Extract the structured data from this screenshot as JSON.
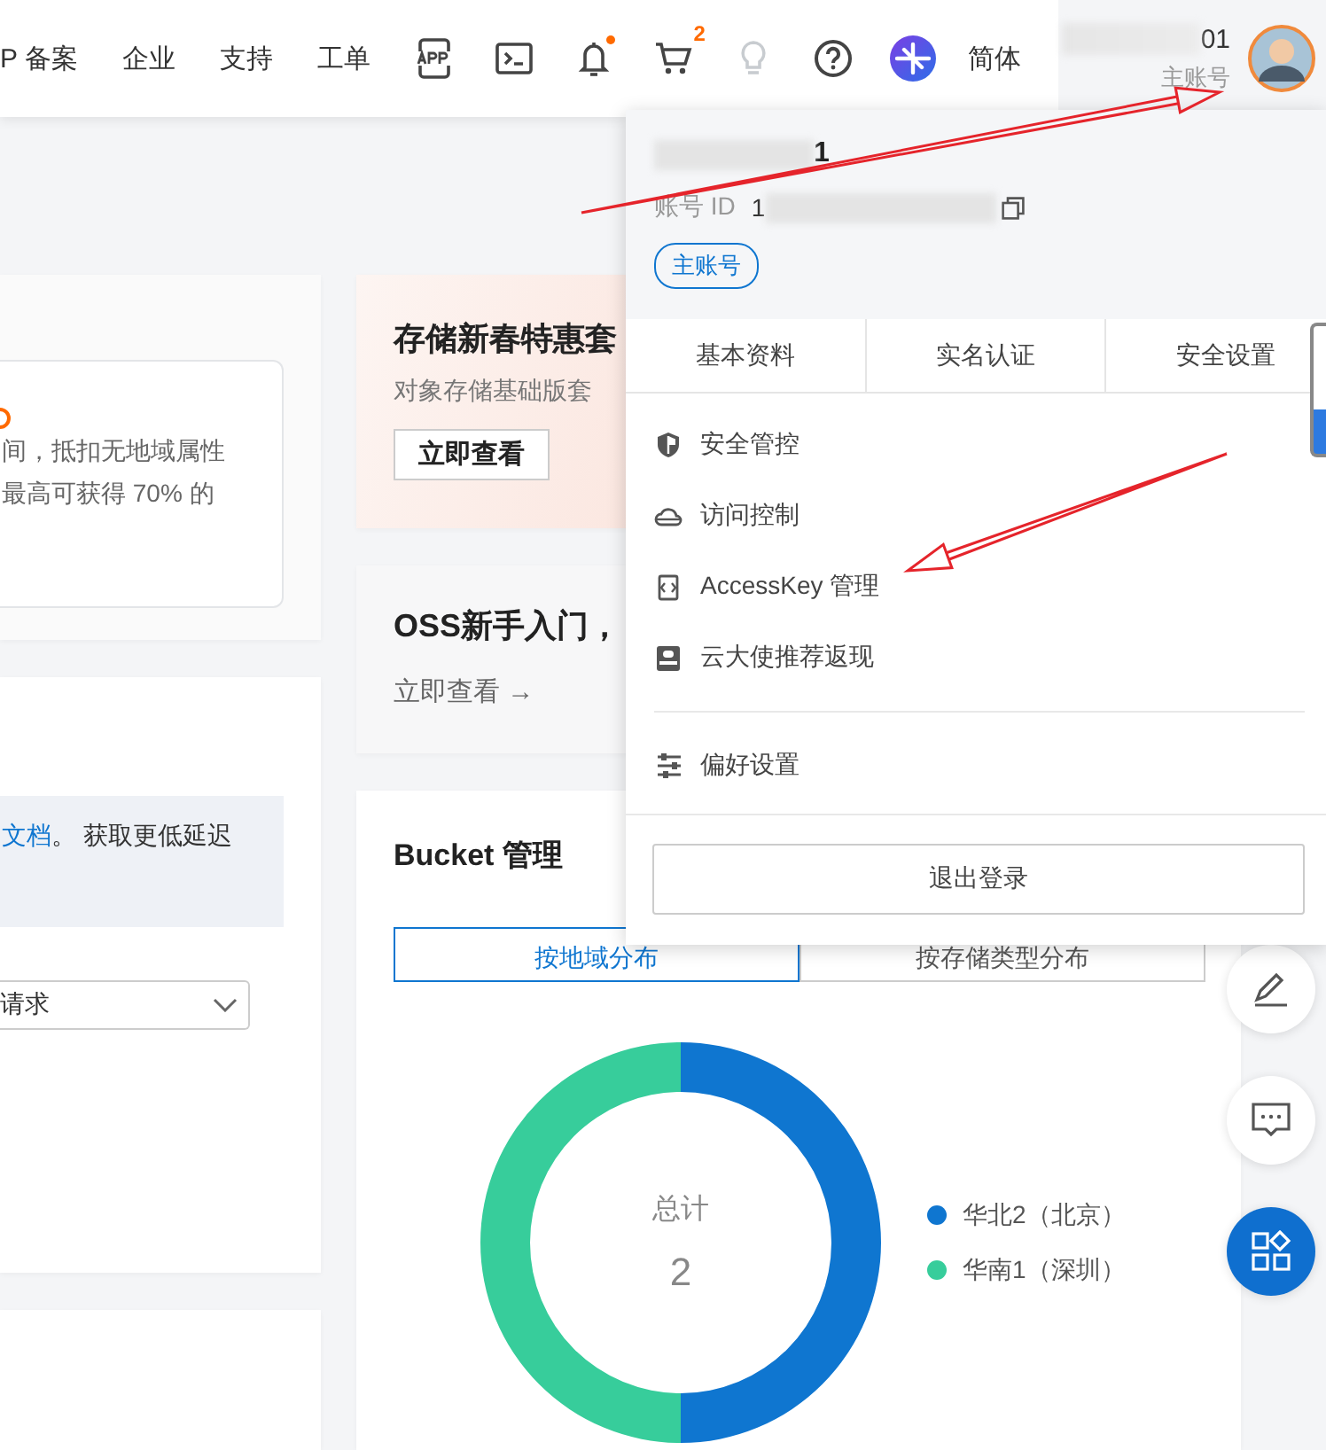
{
  "header": {
    "nav": [
      "P 备案",
      "企业",
      "支持",
      "工单"
    ],
    "tools": [
      {
        "kind": "app"
      },
      {
        "kind": "terminal"
      },
      {
        "kind": "bell",
        "dot": true
      },
      {
        "kind": "cart",
        "badge": "2"
      },
      {
        "kind": "bulb",
        "disabled": true
      },
      {
        "kind": "help"
      },
      {
        "kind": "logo"
      }
    ],
    "language": "简体",
    "account": {
      "name_tail": "01",
      "role": "主账号"
    }
  },
  "left_column": {
    "offer_card": {
      "lines": [
        "间，抵扣无地域属性",
        "最高可获得 70% 的"
      ]
    },
    "tip_card": {
      "link": "文档",
      "text": "。 获取更低延迟",
      "select": "请求"
    }
  },
  "promo_card": {
    "title": "存储新春特惠套",
    "subtitle": "对象存储基础版套",
    "button": "立即查看"
  },
  "guide_card": {
    "title": "OSS新手入门，",
    "link": "立即查看 →"
  },
  "bucket_card": {
    "title": "Bucket 管理",
    "tabs": [
      {
        "label": "按地域分布",
        "selected": true
      },
      {
        "label": "按存储类型分布",
        "selected": false
      }
    ],
    "total_label": "总计",
    "total": "2",
    "chart_data": {
      "type": "donut",
      "categories": [
        "华北2（北京）",
        "华南1（深圳）"
      ],
      "values": [
        1,
        1
      ],
      "colors": [
        "#0f76d0",
        "#37cd9b"
      ],
      "legend": true
    }
  },
  "float_tools": [
    {
      "kind": "edit",
      "active": false
    },
    {
      "kind": "chat",
      "active": false
    },
    {
      "kind": "apps",
      "active": true
    }
  ],
  "account_menu": {
    "name_tail": "1",
    "id_label": "账号 ID",
    "id_head": "1",
    "role_badge": "主账号",
    "tabs": [
      "基本资料",
      "实名认证",
      "安全设置"
    ],
    "item_groups": [
      [
        {
          "kind": "shield",
          "label": "安全管控"
        },
        {
          "kind": "cloud",
          "label": "访问控制"
        },
        {
          "kind": "key",
          "label": "AccessKey 管理"
        },
        {
          "kind": "ambassador",
          "label": "云大使推荐返现"
        }
      ],
      [
        {
          "kind": "sliders",
          "label": "偏好设置"
        }
      ]
    ],
    "logout": "退出登录"
  }
}
